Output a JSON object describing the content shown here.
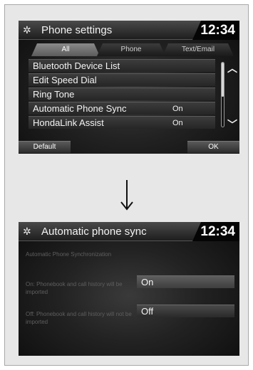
{
  "screen1": {
    "icon": "gear-icon",
    "title": "Phone settings",
    "clock": "12:34",
    "tabs": [
      {
        "label": "All",
        "active": true
      },
      {
        "label": "Phone",
        "active": false
      },
      {
        "label": "Text/Email",
        "active": false
      }
    ],
    "items": [
      {
        "label": "Bluetooth Device List",
        "value": ""
      },
      {
        "label": "Edit Speed Dial",
        "value": ""
      },
      {
        "label": "Ring Tone",
        "value": ""
      },
      {
        "label": "Automatic Phone Sync",
        "value": "On"
      },
      {
        "label": "HondaLink Assist",
        "value": "On"
      }
    ],
    "buttons": {
      "default": "Default",
      "ok": "OK"
    }
  },
  "arrow": {
    "icon": "down-arrow-icon"
  },
  "screen2": {
    "icon": "gear-icon",
    "title": "Automatic phone sync",
    "clock": "12:34",
    "help": [
      "Automatic Phone Synchronization",
      "On: Phonebook and call history will be imported",
      "Off: Phonebook and call history will not be imported"
    ],
    "options": [
      {
        "label": "On",
        "selected": true
      },
      {
        "label": "Off",
        "selected": false
      }
    ]
  }
}
